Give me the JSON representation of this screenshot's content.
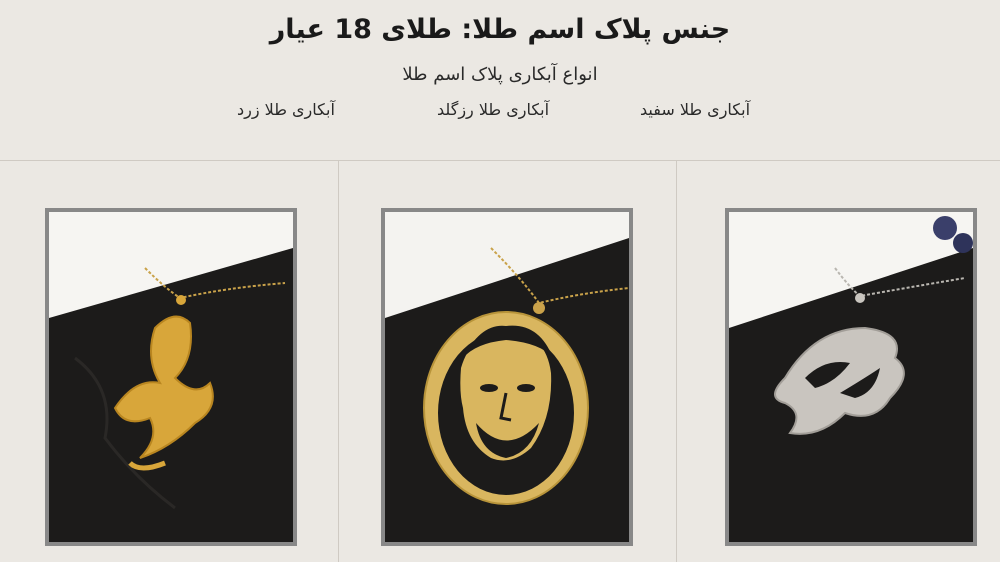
{
  "page": {
    "title": "جنس پلاک اسم طلا: طلای 18 عیار",
    "subtitle": "انواع آبکاری پلاک اسم طلا"
  },
  "plating_links": [
    {
      "label": "آبکاری طلا سفید",
      "color": "#c9c9c9"
    },
    {
      "label": "آبکاری طلا رزگلد",
      "color": "#d7a07a"
    },
    {
      "label": "آبکاری طلا زرد",
      "color": "#d9a93a"
    }
  ],
  "products": [
    {
      "alt": "yellow-gold-name-pendant",
      "metal": "#d8a63a"
    },
    {
      "alt": "gold-portrait-pendant",
      "metal": "#caa24a"
    },
    {
      "alt": "white-gold-name-pendant",
      "metal": "#c9c5bf"
    }
  ],
  "colors": {
    "background": "#ebe8e3",
    "divider": "#cfcac3",
    "card_frame": "#888888",
    "velvet": "#1c1b1a"
  }
}
